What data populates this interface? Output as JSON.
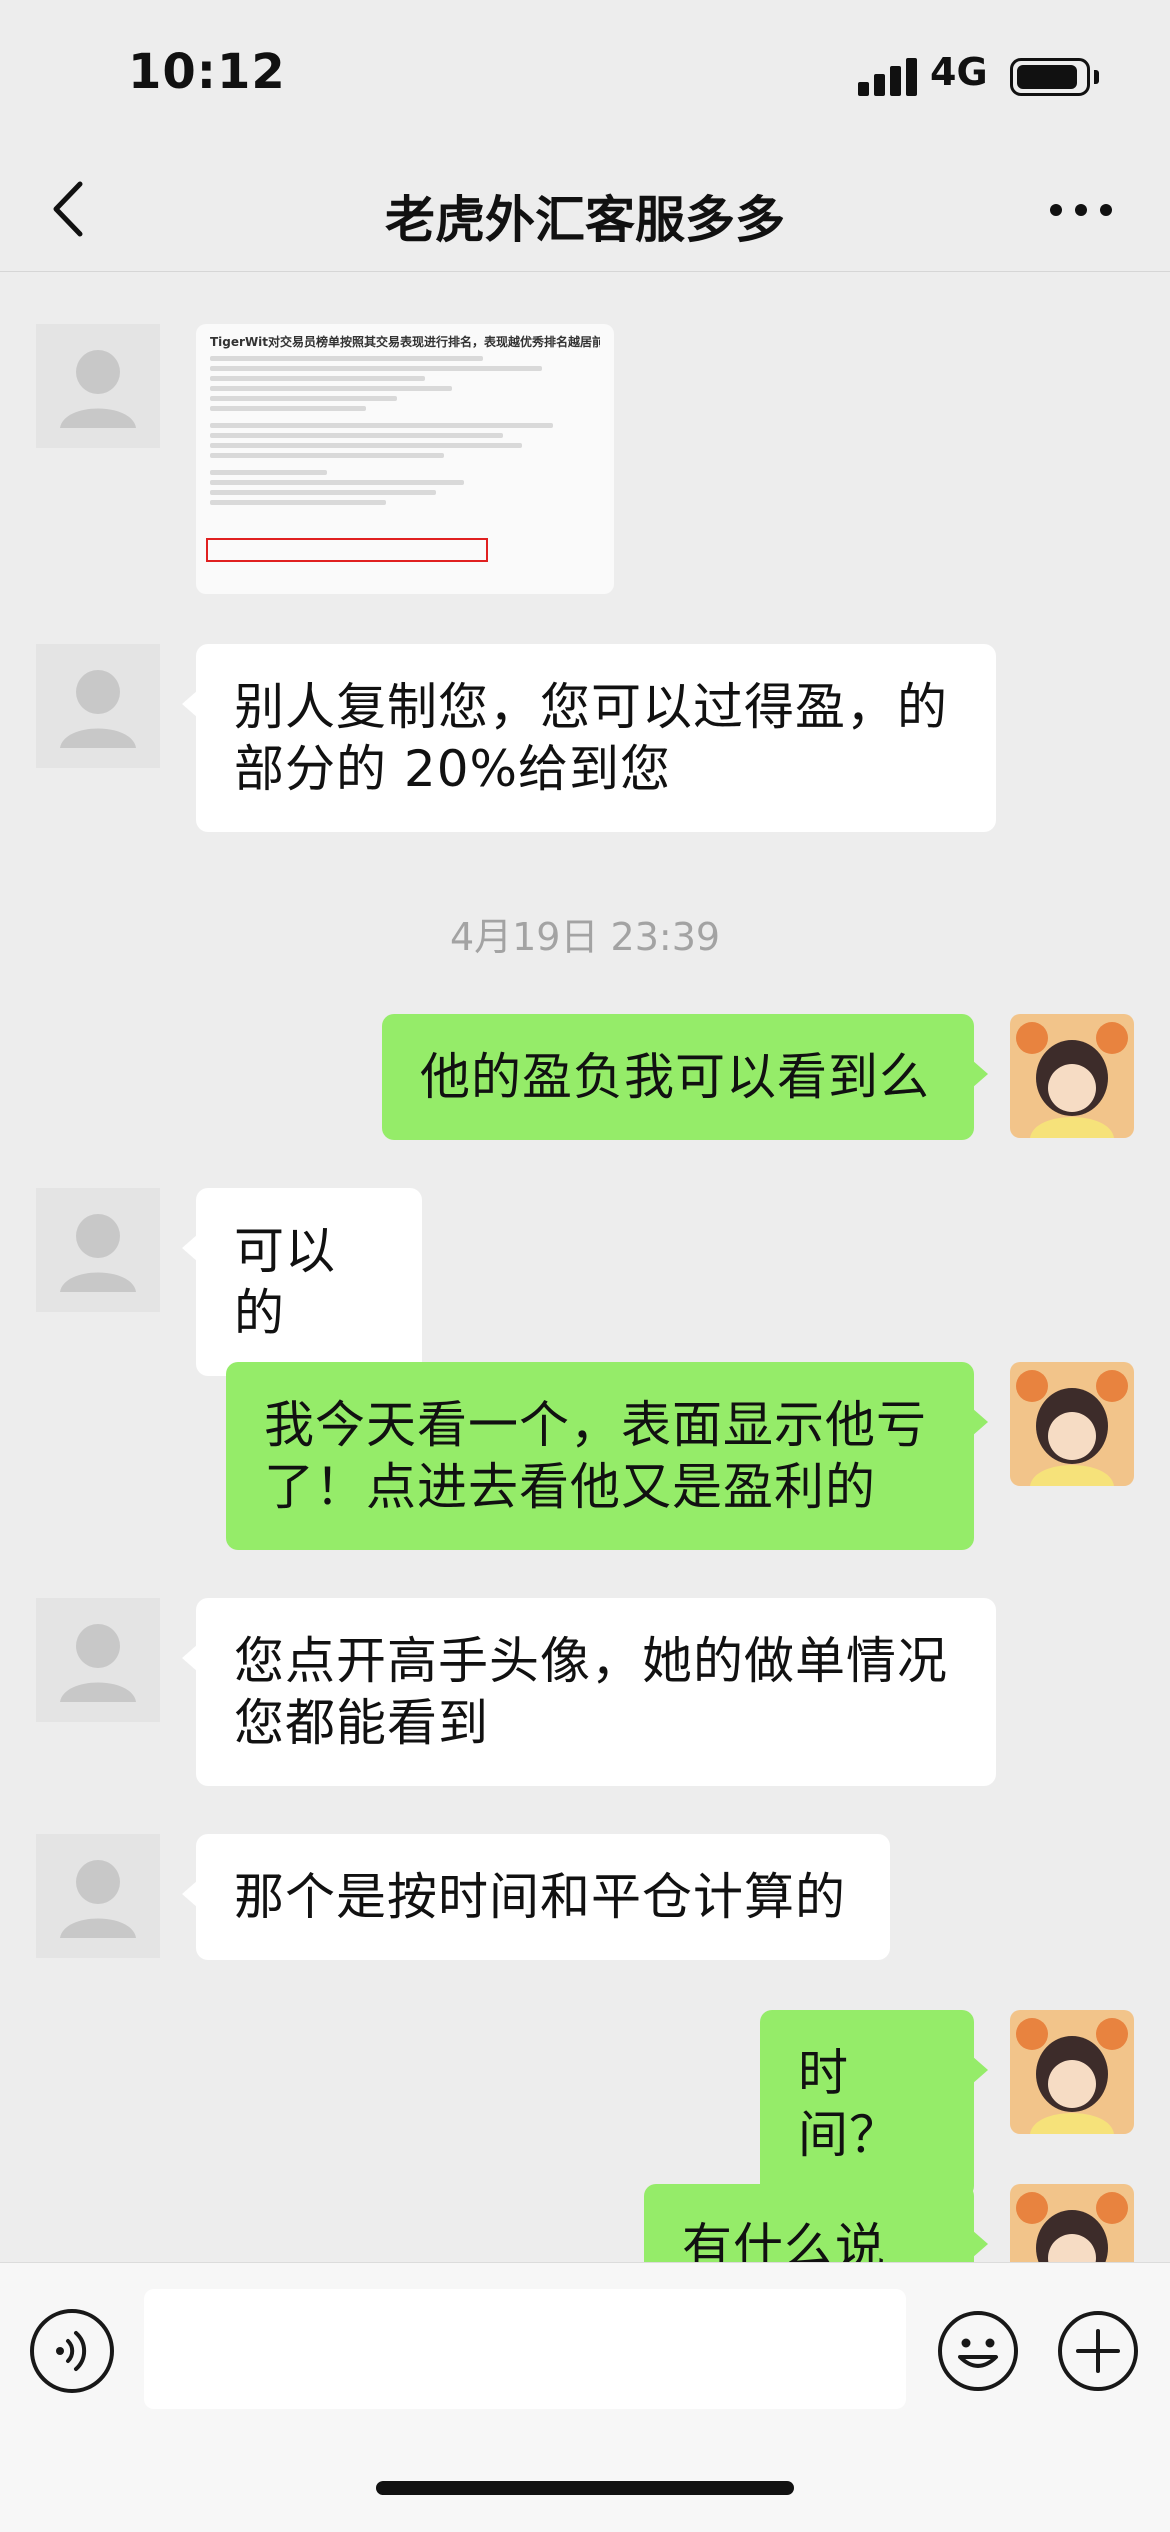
{
  "status_bar": {
    "time": "10:12",
    "network": "4G"
  },
  "nav": {
    "title": "老虎外汇客服多多"
  },
  "image_message": {
    "title": "TigerWit对交易员榜单按照其交易表现进行排名，表现越优秀排名越居前端。"
  },
  "messages": [
    {
      "side": "in",
      "text_line1": "别人复制您，您可以过得盈，的",
      "text_line2": "部分的 20%给到您"
    },
    {
      "timestamp": "4月19日 23:39"
    },
    {
      "side": "out",
      "text": "他的盈负我可以看到么"
    },
    {
      "side": "in",
      "text": "可以的"
    },
    {
      "side": "out",
      "text_line1": "我今天看一个，表面显示他亏",
      "text_line2": "了！点进去看他又是盈利的"
    },
    {
      "side": "in",
      "text_line1": "您点开高手头像，她的做单情况",
      "text_line2": "您都能看到"
    },
    {
      "side": "in",
      "text": "那个是按时间和平仓计算的"
    },
    {
      "side": "out",
      "text": "时间？"
    },
    {
      "side": "out",
      "text": "有什么说法"
    }
  ],
  "input_bar": {
    "value": ""
  },
  "icons": {
    "back": "chevron-left-icon",
    "more": "more-dots-icon",
    "voice": "voice-icon",
    "emoji": "emoji-icon",
    "plus": "plus-icon"
  },
  "colors": {
    "out_bubble": "#95ec69",
    "in_bubble": "#ffffff",
    "background": "#ededed"
  }
}
